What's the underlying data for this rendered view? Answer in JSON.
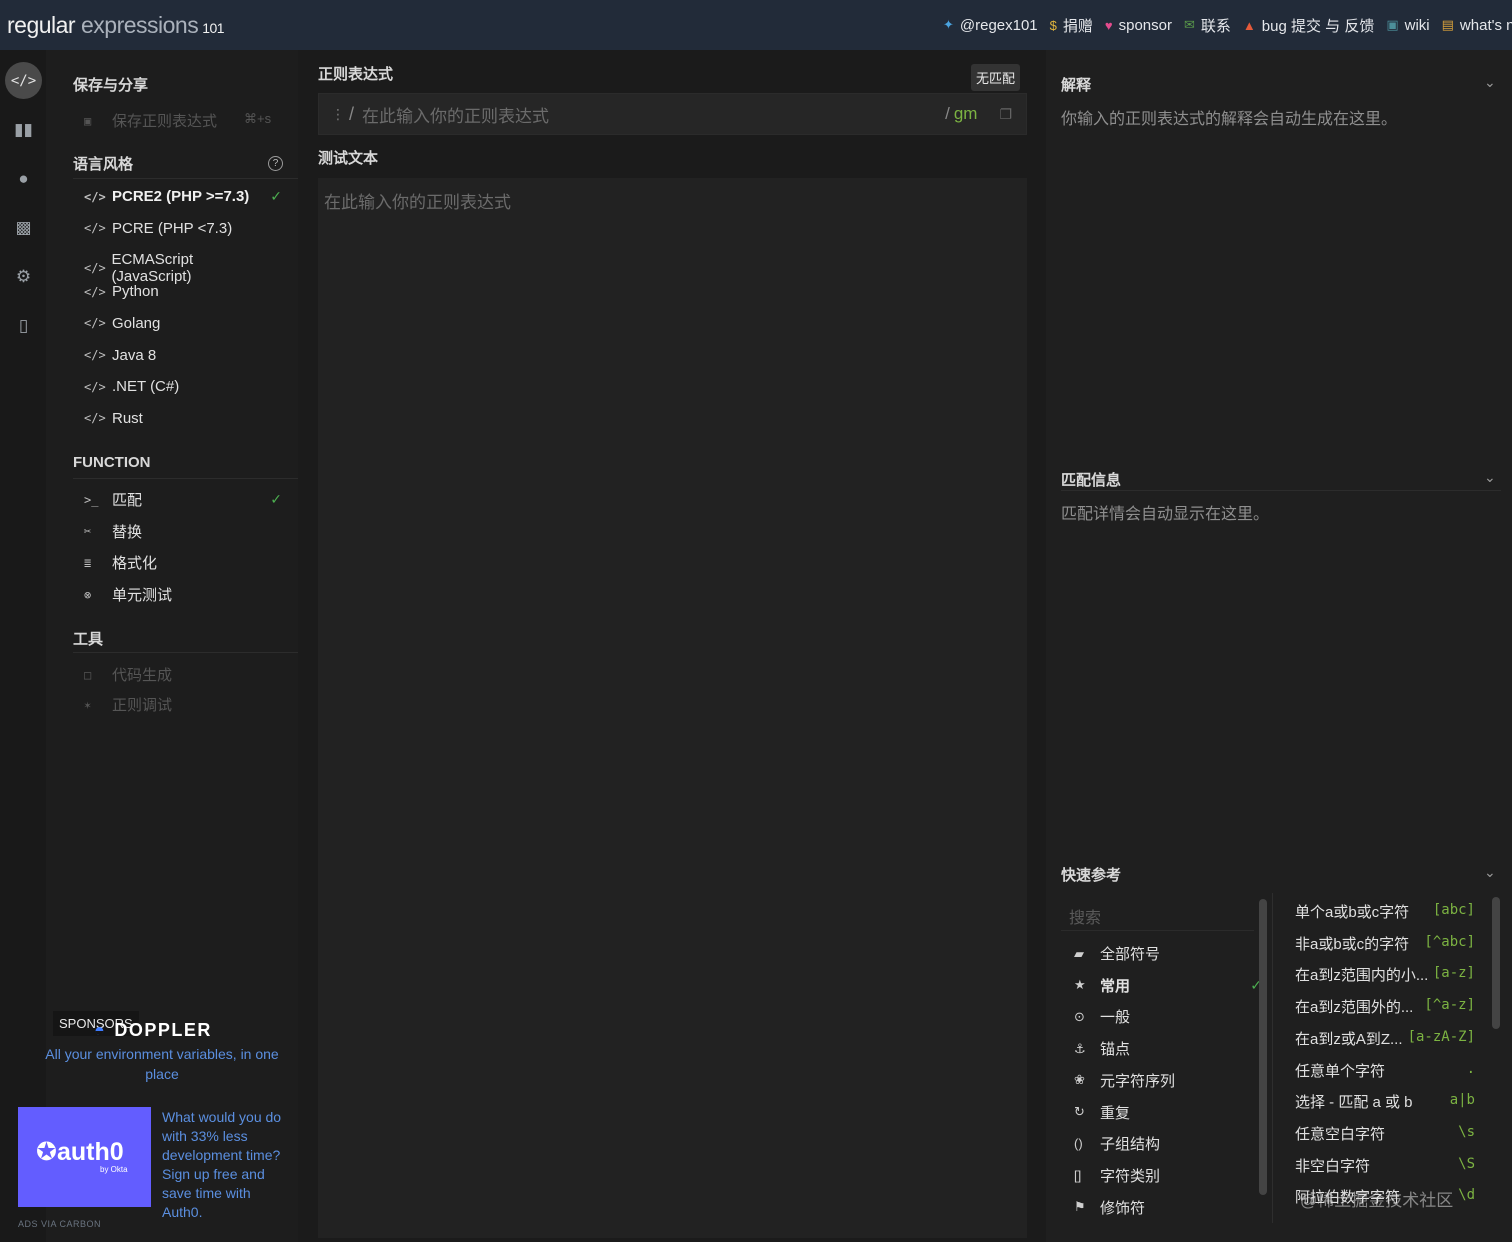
{
  "header": {
    "brand_main": "regular",
    "brand_sub": "expressions",
    "brand_ver": "101",
    "links": [
      {
        "icon": "twitter-icon",
        "glyph": "✦",
        "color": "#4aa3df",
        "label": "@regex101"
      },
      {
        "icon": "dollar-icon",
        "glyph": "$",
        "color": "#e0b43c",
        "label": "捐赠"
      },
      {
        "icon": "heart-icon",
        "glyph": "♥",
        "color": "#e44b8d",
        "label": "sponsor"
      },
      {
        "icon": "mail-icon",
        "glyph": "✉",
        "color": "#5a9a4a",
        "label": "联系"
      },
      {
        "icon": "warning-icon",
        "glyph": "▲",
        "color": "#e55a3a",
        "label": "bug 提交 与 反馈"
      },
      {
        "icon": "wiki-icon",
        "glyph": "▣",
        "color": "#4c8f9a",
        "label": "wiki"
      },
      {
        "icon": "news-icon",
        "glyph": "▤",
        "color": "#d9a13a",
        "label": "what's new?"
      }
    ]
  },
  "sidebar": {
    "save_title": "保存与分享",
    "save_item": "保存正则表达式",
    "save_kbd": "⌘+s",
    "flavor_title": "语言风格",
    "flavors": [
      "PCRE2 (PHP >=7.3)",
      "PCRE (PHP <7.3)",
      "ECMAScript (JavaScript)",
      "Python",
      "Golang",
      "Java 8",
      ".NET (C#)",
      "Rust"
    ],
    "function_title": "FUNCTION",
    "functions": [
      "匹配",
      "替换",
      "格式化",
      "单元测试"
    ],
    "tools_title": "工具",
    "tools": [
      "代码生成",
      "正则调试"
    ]
  },
  "sponsors": {
    "tag": "SPONSORS",
    "doppler": "DOPPLER",
    "doppler_desc": "All your environment variables, in one place",
    "auth0_logo": "auth0",
    "auth0_by": "by Okta",
    "ad_text": "What would you do with 33% less development time? Sign up free and save time with Auth0.",
    "ads_via": "ADS VIA CARBON"
  },
  "editor": {
    "regex_title": "正则表达式",
    "nomatch": "无匹配",
    "regex_placeholder": "在此输入你的正则表达式",
    "flags": "gm",
    "test_title": "测试文本",
    "test_placeholder": "在此输入你的正则表达式"
  },
  "right": {
    "explain_title": "解释",
    "explain_text": "你输入的正则表达式的解释会自动生成在这里。",
    "match_title": "匹配信息",
    "match_text": "匹配详情会自动显示在这里。",
    "quickref_title": "快速参考",
    "search_placeholder": "搜索",
    "categories": [
      "全部符号",
      "常用",
      "一般",
      "锚点",
      "元字符序列",
      "重复",
      "子组结构",
      "字符类别",
      "修饰符"
    ],
    "refs": [
      {
        "label": "单个a或b或c字符",
        "token": "[abc]"
      },
      {
        "label": "非a或b或c的字符",
        "token": "[^abc]"
      },
      {
        "label": "在a到z范围内的小...",
        "token": "[a-z]"
      },
      {
        "label": "在a到z范围外的...",
        "token": "[^a-z]"
      },
      {
        "label": "在a到z或A到Z...",
        "token": "[a-zA-Z]"
      },
      {
        "label": "任意单个字符",
        "token": "."
      },
      {
        "label": "选择 - 匹配 a 或 b",
        "token": "a|b"
      },
      {
        "label": "任意空白字符",
        "token": "\\s"
      },
      {
        "label": "非空白字符",
        "token": "\\S"
      },
      {
        "label": "阿拉伯数字字符",
        "token": "\\d"
      }
    ]
  },
  "watermark": "@稀土掘金技术社区"
}
